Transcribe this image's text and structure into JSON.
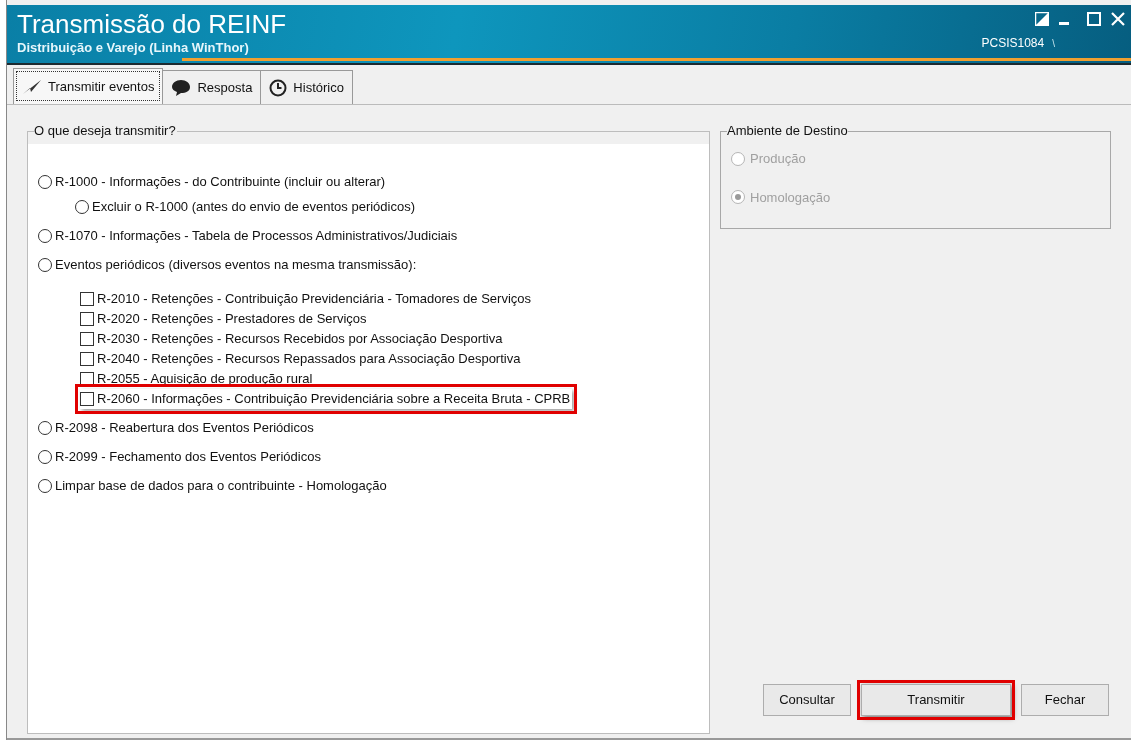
{
  "window": {
    "title": "Transmissão do REINF",
    "subtitle": "Distribuição e Varejo (Linha WinThor)",
    "code": "PCSIS1084",
    "code_mark": "\\"
  },
  "tabs": [
    {
      "label": "Transmitir eventos",
      "kind": "send",
      "selected": true
    },
    {
      "label": "Resposta",
      "kind": "chat",
      "selected": false
    },
    {
      "label": "Histórico",
      "kind": "clock",
      "selected": false
    }
  ],
  "events_group": {
    "title": "O que deseja transmitir?",
    "options": [
      {
        "kind": "radio",
        "label": "R-1000 - Informações - do Contribuinte (incluir ou alterar)",
        "selected": false,
        "children": [
          {
            "kind": "radio",
            "label": "Excluir o R-1000 (antes do envio de eventos periódicos)",
            "selected": false
          }
        ]
      },
      {
        "kind": "radio",
        "label": "R-1070 - Informações - Tabela de Processos Administrativos/Judiciais",
        "selected": false
      },
      {
        "kind": "radio",
        "label": "Eventos periódicos (diversos eventos na mesma transmissão):",
        "selected": false,
        "children": [
          {
            "kind": "checkbox",
            "label": "R-2010 - Retenções - Contribuição Previdenciária - Tomadores de Serviços",
            "checked": false,
            "highlighted": false
          },
          {
            "kind": "checkbox",
            "label": "R-2020 - Retenções - Prestadores de Serviços",
            "checked": false,
            "highlighted": false
          },
          {
            "kind": "checkbox",
            "label": "R-2030 - Retenções - Recursos Recebidos por Associação Desportiva",
            "checked": false,
            "highlighted": false
          },
          {
            "kind": "checkbox",
            "label": "R-2040 - Retenções - Recursos Repassados para Associação Desportiva",
            "checked": false,
            "highlighted": false
          },
          {
            "kind": "checkbox",
            "label": "R-2055 - Aquisição de produção rural",
            "checked": false,
            "highlighted": false
          },
          {
            "kind": "checkbox",
            "label": "R-2060 - Informações - Contribuição Previdenciária sobre a Receita Bruta - CPRB",
            "checked": false,
            "highlighted": true
          }
        ]
      },
      {
        "kind": "radio",
        "label": "R-2098 - Reabertura dos Eventos Periódicos",
        "selected": false
      },
      {
        "kind": "radio",
        "label": "R-2099 - Fechamento dos Eventos Periódicos",
        "selected": false
      },
      {
        "kind": "radio",
        "label": "Limpar base de dados para o contribuinte - Homologação",
        "selected": false
      }
    ]
  },
  "destination_group": {
    "title": "Ambiente de Destino",
    "options": [
      {
        "label": "Produção",
        "selected": false,
        "disabled": true
      },
      {
        "label": "Homologação",
        "selected": true,
        "disabled": true
      }
    ]
  },
  "buttons": [
    {
      "label": "Consultar",
      "highlighted": false
    },
    {
      "label": "Transmitir",
      "highlighted": true
    },
    {
      "label": "Fechar",
      "highlighted": false
    }
  ]
}
